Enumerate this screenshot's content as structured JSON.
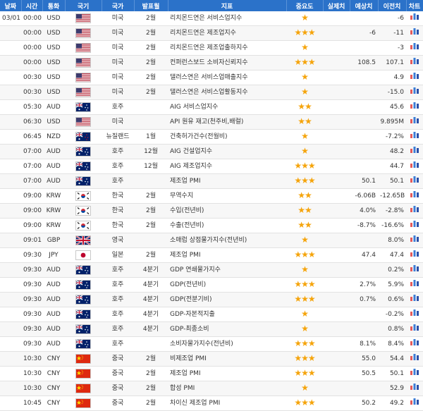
{
  "headers": [
    "날짜",
    "시간",
    "통화",
    "국기",
    "국가",
    "발표월",
    "지표",
    "중요도",
    "실제치",
    "예상치",
    "이전치",
    "차트"
  ],
  "flags": {
    "USD": {
      "colors": {
        "stripe": "#b22234",
        "canton": "#3c3b6e"
      }
    },
    "AUD": {
      "colors": {
        "field": "#012169",
        "cross": "#c8102e"
      }
    },
    "NZD": {
      "colors": {
        "field": "#012169",
        "star": "#c8102e"
      }
    },
    "KRW": {
      "colors": {
        "red": "#cd2e3a",
        "blue": "#0047a0"
      }
    },
    "GBP": {
      "colors": {
        "field": "#012169",
        "cross": "#c8102e"
      }
    },
    "JPY": {
      "colors": {
        "disc": "#bc002d"
      }
    },
    "CNY": {
      "colors": {
        "field": "#de2910",
        "star": "#ffde00"
      }
    }
  },
  "rows": [
    {
      "date": "03/01",
      "time": "00:00",
      "currency": "USD",
      "country": "미국",
      "month": "2월",
      "indicator": "리치몬드연은 서비스업지수",
      "stars": 1,
      "actual": "",
      "forecast": "",
      "previous": "-6"
    },
    {
      "date": "",
      "time": "00:00",
      "currency": "USD",
      "country": "미국",
      "month": "2월",
      "indicator": "리치몬드연은 제조업지수",
      "stars": 3,
      "actual": "",
      "forecast": "-6",
      "previous": "-11"
    },
    {
      "date": "",
      "time": "00:00",
      "currency": "USD",
      "country": "미국",
      "month": "2월",
      "indicator": "리치몬드연은 제조업출하지수",
      "stars": 1,
      "actual": "",
      "forecast": "",
      "previous": "-3"
    },
    {
      "date": "",
      "time": "00:00",
      "currency": "USD",
      "country": "미국",
      "month": "2월",
      "indicator": "컨퍼런스보드 소비자신뢰지수",
      "stars": 3,
      "actual": "",
      "forecast": "108.5",
      "previous": "107.1"
    },
    {
      "date": "",
      "time": "00:30",
      "currency": "USD",
      "country": "미국",
      "month": "2월",
      "indicator": "댈러스연은 서비스업매출지수",
      "stars": 1,
      "actual": "",
      "forecast": "",
      "previous": "4.9"
    },
    {
      "date": "",
      "time": "00:30",
      "currency": "USD",
      "country": "미국",
      "month": "2월",
      "indicator": "댈러스연은 서비스업활동지수",
      "stars": 1,
      "actual": "",
      "forecast": "",
      "previous": "-15.0"
    },
    {
      "date": "",
      "time": "05:30",
      "currency": "AUD",
      "country": "호주",
      "month": "",
      "indicator": "AIG 서비스업지수",
      "stars": 2,
      "actual": "",
      "forecast": "",
      "previous": "45.6"
    },
    {
      "date": "",
      "time": "06:30",
      "currency": "USD",
      "country": "미국",
      "month": "",
      "indicator": "API 원유 재고(천주비,배럴)",
      "stars": 2,
      "actual": "",
      "forecast": "",
      "previous": "9.895M"
    },
    {
      "date": "",
      "time": "06:45",
      "currency": "NZD",
      "country": "뉴질랜드",
      "month": "1월",
      "indicator": "건축허가건수(전월비)",
      "stars": 1,
      "actual": "",
      "forecast": "",
      "previous": "-7.2%"
    },
    {
      "date": "",
      "time": "07:00",
      "currency": "AUD",
      "country": "호주",
      "month": "12월",
      "indicator": "AIG 건설업지수",
      "stars": 1,
      "actual": "",
      "forecast": "",
      "previous": "48.2"
    },
    {
      "date": "",
      "time": "07:00",
      "currency": "AUD",
      "country": "호주",
      "month": "12월",
      "indicator": "AIG 제조업지수",
      "stars": 3,
      "actual": "",
      "forecast": "",
      "previous": "44.7"
    },
    {
      "date": "",
      "time": "07:00",
      "currency": "AUD",
      "country": "호주",
      "month": "",
      "indicator": "제조업 PMI",
      "stars": 3,
      "actual": "",
      "forecast": "50.1",
      "previous": "50.1"
    },
    {
      "date": "",
      "time": "09:00",
      "currency": "KRW",
      "country": "한국",
      "month": "2월",
      "indicator": "무역수지",
      "stars": 2,
      "actual": "",
      "forecast": "-6.06B",
      "previous": "-12.65B"
    },
    {
      "date": "",
      "time": "09:00",
      "currency": "KRW",
      "country": "한국",
      "month": "2월",
      "indicator": "수입(전년비)",
      "stars": 2,
      "actual": "",
      "forecast": "4.0%",
      "previous": "-2.8%"
    },
    {
      "date": "",
      "time": "09:00",
      "currency": "KRW",
      "country": "한국",
      "month": "2월",
      "indicator": "수출(전년비)",
      "stars": 2,
      "actual": "",
      "forecast": "-8.7%",
      "previous": "-16.6%"
    },
    {
      "date": "",
      "time": "09:01",
      "currency": "GBP",
      "country": "영국",
      "month": "",
      "indicator": "소매럽 상점물가지수(전년비)",
      "stars": 1,
      "actual": "",
      "forecast": "",
      "previous": "8.0%"
    },
    {
      "date": "",
      "time": "09:30",
      "currency": "JPY",
      "country": "일본",
      "month": "2월",
      "indicator": "제조업 PMI",
      "stars": 3,
      "actual": "",
      "forecast": "47.4",
      "previous": "47.4"
    },
    {
      "date": "",
      "time": "09:30",
      "currency": "AUD",
      "country": "호주",
      "month": "4분기",
      "indicator": "GDP 연쇄물가지수",
      "stars": 1,
      "actual": "",
      "forecast": "",
      "previous": "0.2%"
    },
    {
      "date": "",
      "time": "09:30",
      "currency": "AUD",
      "country": "호주",
      "month": "4분기",
      "indicator": "GDP(전년비)",
      "stars": 3,
      "actual": "",
      "forecast": "2.7%",
      "previous": "5.9%"
    },
    {
      "date": "",
      "time": "09:30",
      "currency": "AUD",
      "country": "호주",
      "month": "4분기",
      "indicator": "GDP(전분기비)",
      "stars": 3,
      "actual": "",
      "forecast": "0.7%",
      "previous": "0.6%"
    },
    {
      "date": "",
      "time": "09:30",
      "currency": "AUD",
      "country": "호주",
      "month": "4분기",
      "indicator": "GDP-자본적지출",
      "stars": 1,
      "actual": "",
      "forecast": "",
      "previous": "-0.2%"
    },
    {
      "date": "",
      "time": "09:30",
      "currency": "AUD",
      "country": "호주",
      "month": "4분기",
      "indicator": "GDP-최종소비",
      "stars": 1,
      "actual": "",
      "forecast": "",
      "previous": "0.8%"
    },
    {
      "date": "",
      "time": "09:30",
      "currency": "AUD",
      "country": "호주",
      "month": "",
      "indicator": "소비자물가지수(전년비)",
      "stars": 3,
      "actual": "",
      "forecast": "8.1%",
      "previous": "8.4%"
    },
    {
      "date": "",
      "time": "10:30",
      "currency": "CNY",
      "country": "중국",
      "month": "2월",
      "indicator": "비제조업 PMI",
      "stars": 3,
      "actual": "",
      "forecast": "55.0",
      "previous": "54.4"
    },
    {
      "date": "",
      "time": "10:30",
      "currency": "CNY",
      "country": "중국",
      "month": "2월",
      "indicator": "제조업 PMI",
      "stars": 3,
      "actual": "",
      "forecast": "50.5",
      "previous": "50.1"
    },
    {
      "date": "",
      "time": "10:30",
      "currency": "CNY",
      "country": "중국",
      "month": "2월",
      "indicator": "합성 PMI",
      "stars": 1,
      "actual": "",
      "forecast": "",
      "previous": "52.9"
    },
    {
      "date": "",
      "time": "10:45",
      "currency": "CNY",
      "country": "중국",
      "month": "2월",
      "indicator": "차이신 제조업 PMI",
      "stars": 3,
      "actual": "",
      "forecast": "50.2",
      "previous": "49.2"
    }
  ],
  "chart_icon_colors": {
    "bar1": "#e45a5a",
    "bar2": "#3a7bd5",
    "bar3": "#2a4fa8"
  }
}
